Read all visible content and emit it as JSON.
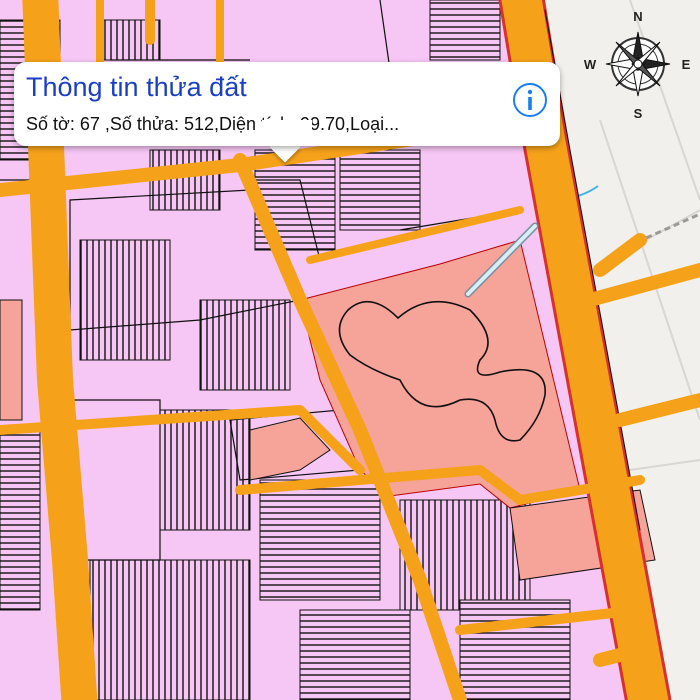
{
  "popup": {
    "title": "Thông tin thửa đất",
    "details": "Số tờ: 67 ,Số thửa: 512,Diện tích: 99.70,Loại..."
  },
  "info_button": {
    "icon": "info-icon"
  },
  "compass": {
    "north": "N",
    "south": "S",
    "east": "E",
    "west": "W"
  },
  "colors": {
    "parcel": "#f6c6f4",
    "road": "#f5a21a",
    "parcel_border": "#1a1a1a",
    "highlight_area": "#f6a39a",
    "background": "#f2f0ec",
    "title": "#1a3fc4"
  }
}
